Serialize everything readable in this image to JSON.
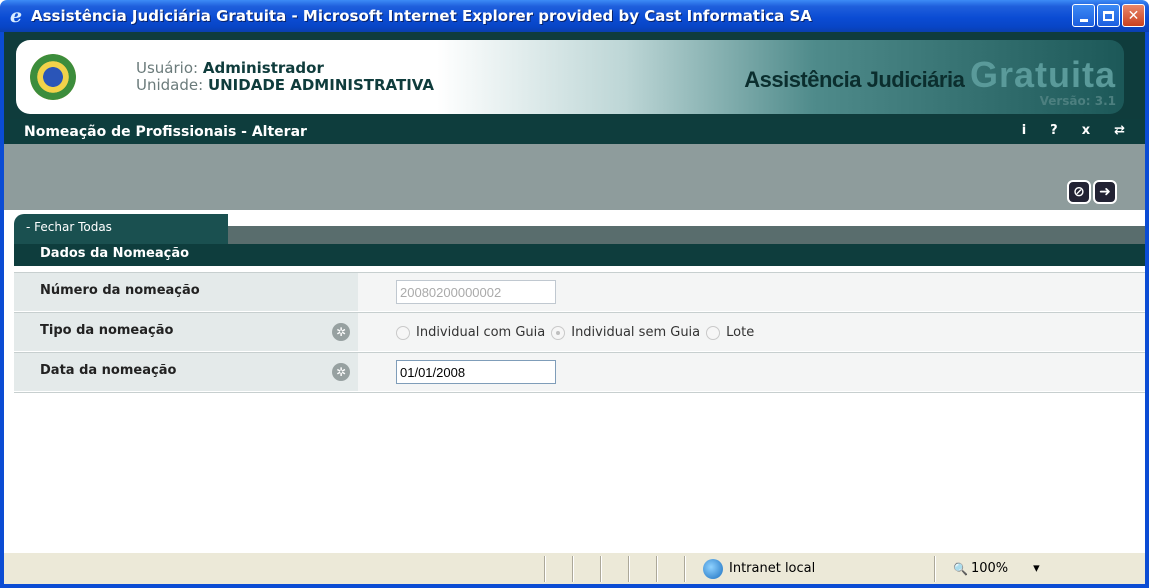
{
  "window": {
    "title": "Assistência Judiciária Gratuita - Microsoft Internet Explorer provided by Cast Informatica SA",
    "ie_icon": "e"
  },
  "header": {
    "user_label": "Usuário:",
    "user_value": "Administrador",
    "unit_label": "Unidade:",
    "unit_value": "UNIDADE ADMINISTRATIVA",
    "brand_part1": "Assistência Judiciária",
    "brand_part2": "Gratuita",
    "version": "Versão: 3.1"
  },
  "page": {
    "title": "Nomeação de Profissionais - Alterar",
    "icons": [
      "i",
      "?",
      "x",
      "⇄"
    ]
  },
  "toolbar": {
    "cancel_glyph": "⊘",
    "next_glyph": "➜"
  },
  "tab": {
    "label": "- Fechar Todas"
  },
  "section": {
    "title": "Dados da Nomeação"
  },
  "form": {
    "numero": {
      "label": "Número da nomeação",
      "value": "20080200000002"
    },
    "tipo": {
      "label": "Tipo da nomeação",
      "required_glyph": "✲",
      "options": [
        "Individual com Guia",
        "Individual sem Guia",
        "Lote"
      ],
      "selected": "Individual sem Guia"
    },
    "data": {
      "label": "Data da nomeação",
      "required_glyph": "✲",
      "value": "01/01/2008"
    }
  },
  "status": {
    "zone": "Intranet local",
    "zoom": "100%",
    "zoom_arrow": "▾"
  }
}
